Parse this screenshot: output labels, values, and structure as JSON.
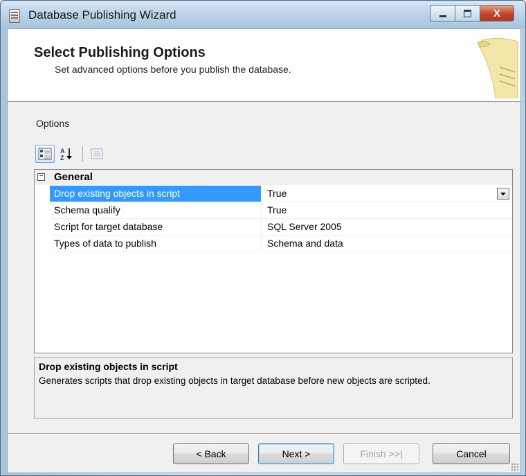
{
  "window": {
    "title": "Database Publishing Wizard",
    "controls": {
      "minimize": "minimize",
      "maximize": "maximize",
      "close": "X"
    }
  },
  "header": {
    "title": "Select Publishing Options",
    "subtitle": "Set advanced options before you publish the database.",
    "graphic_icon": "scroll-paper-icon"
  },
  "options_label": "Options",
  "toolbar": {
    "buttons": [
      {
        "icon": "categorized-icon",
        "active": true
      },
      {
        "icon": "alphabetical-sort-icon",
        "active": false
      },
      {
        "icon": "property-pages-icon",
        "active": false,
        "disabled": true
      }
    ]
  },
  "property_grid": {
    "category": "General",
    "category_toggle": "−",
    "rows": [
      {
        "name": "Drop existing objects in script",
        "value": "True",
        "selected": true
      },
      {
        "name": "Schema qualify",
        "value": "True",
        "selected": false
      },
      {
        "name": "Script for target database",
        "value": "SQL Server 2005",
        "selected": false
      },
      {
        "name": "Types of data to publish",
        "value": "Schema and data",
        "selected": false
      }
    ]
  },
  "description": {
    "title": "Drop existing objects in script",
    "text": "Generates scripts that drop existing objects in target database before new objects are scripted."
  },
  "buttons": {
    "back": "< Back",
    "next": "Next >",
    "finish": "Finish >>|",
    "cancel": "Cancel"
  },
  "colors": {
    "selection": "#3399ff",
    "title_bar": "#bcd3e8",
    "close_button": "#c0452a"
  }
}
